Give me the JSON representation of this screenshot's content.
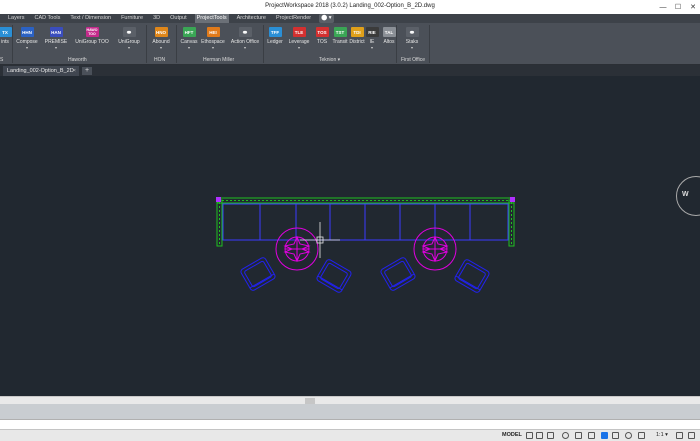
{
  "window": {
    "title": "ProjectWorkspace 2018 (3.0.2)    Landing_002-Option_B_2D.dwg",
    "minimize": "—",
    "maximize": "☐",
    "close": "✕"
  },
  "ribbon_tabs": [
    {
      "label": "Layers"
    },
    {
      "label": "CAD Tools"
    },
    {
      "label": "Text / Dimension"
    },
    {
      "label": "Furniture"
    },
    {
      "label": "3D"
    },
    {
      "label": "Output"
    },
    {
      "label": "ProjectTools"
    },
    {
      "label": "Architecture"
    },
    {
      "label": "ProjectRender"
    },
    {
      "label": "⬤ ▾"
    }
  ],
  "ribbon_buttons": [
    {
      "code": "TX",
      "label": "ints",
      "color": "#2a8fd6"
    },
    {
      "code": "HHN",
      "label": "Compose",
      "color": "#2b62c4"
    },
    {
      "code": "HAN",
      "label": "PREMISE",
      "color": "#3a4dbe"
    },
    {
      "code": "HAWO\nTOO",
      "label": "UniGroup TOO",
      "color": "#c42b8c"
    },
    {
      "code": "⚭",
      "label": "UniGroup",
      "color": "#5b6068"
    },
    {
      "code": "HNO",
      "label": "Abound",
      "color": "#e0871a"
    },
    {
      "code": "HFT",
      "label": "Canvas",
      "color": "#3aa655"
    },
    {
      "code": "HEI",
      "label": "Ethospace",
      "color": "#e07a1a"
    },
    {
      "code": "⚭",
      "label": "Action Office",
      "color": "#5b6068"
    },
    {
      "code": "TFF",
      "label": "Ledger",
      "color": "#2a8fd6"
    },
    {
      "code": "TLE",
      "label": "Leverage",
      "color": "#d43030"
    },
    {
      "code": "TOS",
      "label": "TOS",
      "color": "#d43030"
    },
    {
      "code": "TST",
      "label": "Transit",
      "color": "#3aa655"
    },
    {
      "code": "TDI",
      "label": "District",
      "color": "#e0a01a"
    },
    {
      "code": "RIE",
      "label": "IE",
      "color": "#3b3b3b"
    },
    {
      "code": "TAL",
      "label": "Altos",
      "color": "#8a8f96"
    },
    {
      "code": "⚭",
      "label": "Staks",
      "color": "#5b6068"
    }
  ],
  "ribbon_groups": [
    {
      "label": "S"
    },
    {
      "label": "Haworth"
    },
    {
      "label": "HON"
    },
    {
      "label": "Herman Miller"
    },
    {
      "label": "Teknion ▾"
    },
    {
      "label": "First Office"
    }
  ],
  "document_tabs": [
    {
      "label": "Landing_002-Option_B_2D",
      "close": "×"
    }
  ],
  "new_tab": "+",
  "navwheel": {
    "label": "W"
  },
  "command_line": {
    "placeholder": "nd"
  },
  "status": {
    "mode": "MODEL",
    "scale": "1:1 ▾"
  },
  "drawing_colors": {
    "wall": "#20c020",
    "worksurface": "#3a3aff",
    "table": "#e000e0",
    "chair": "#2222ee",
    "crosshair": "#e8e8e8"
  }
}
